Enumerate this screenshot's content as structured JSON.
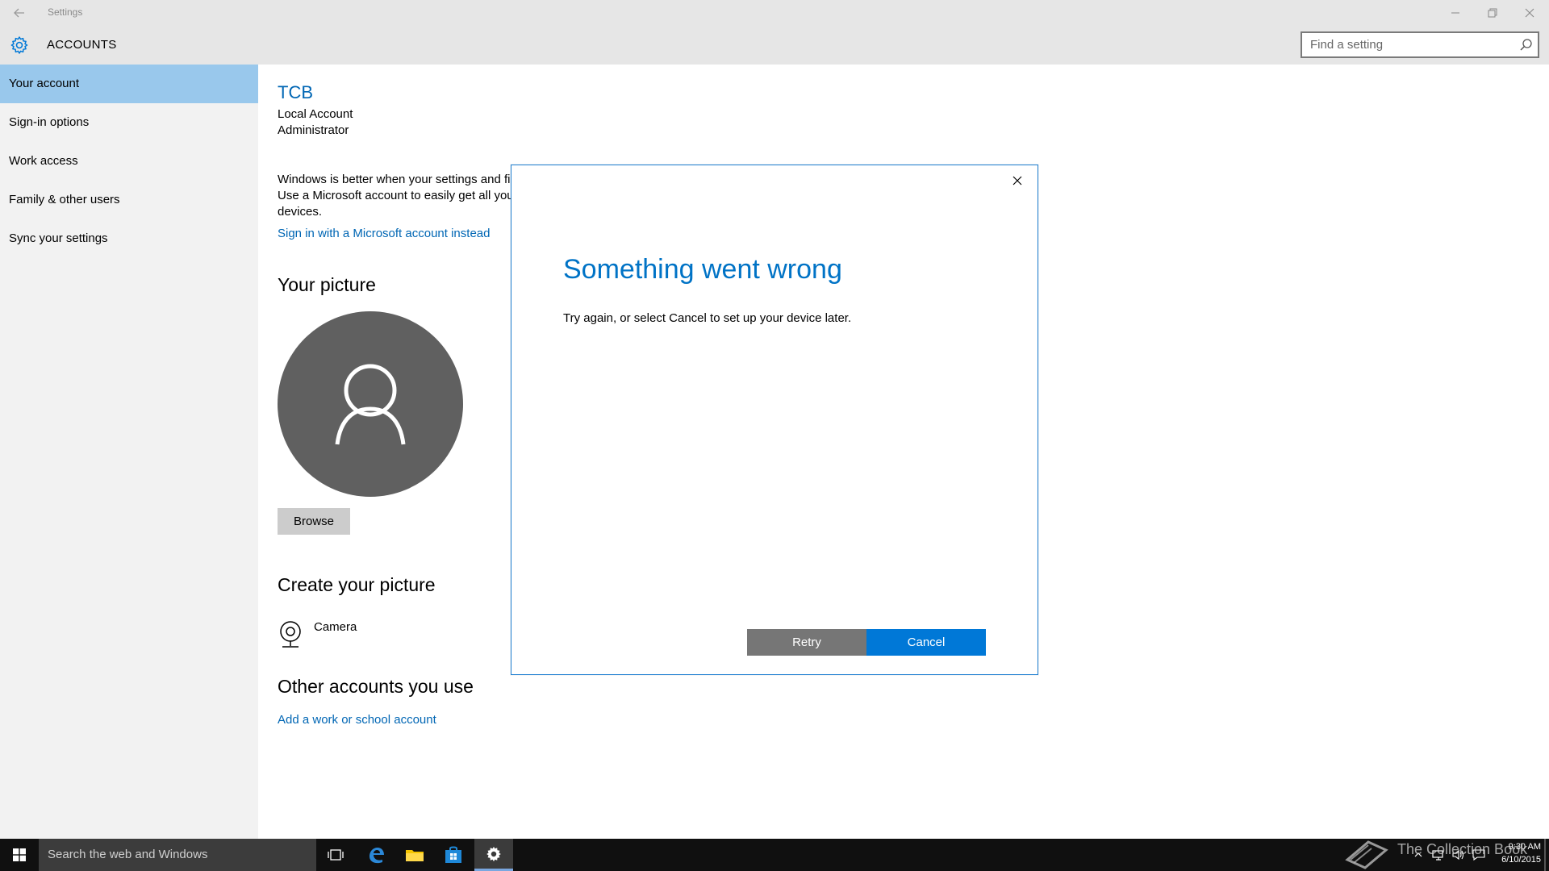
{
  "window": {
    "app_title": "Settings"
  },
  "header": {
    "section_title": "ACCOUNTS",
    "search_placeholder": "Find a setting"
  },
  "sidebar": {
    "items": [
      {
        "label": "Your account",
        "active": true
      },
      {
        "label": "Sign-in options",
        "active": false
      },
      {
        "label": "Work access",
        "active": false
      },
      {
        "label": "Family & other users",
        "active": false
      },
      {
        "label": "Sync your settings",
        "active": false
      }
    ]
  },
  "main": {
    "user_name": "TCB",
    "account_type": "Local Account",
    "role": "Administrator",
    "info_lines": [
      "Windows is better when your settings and fi",
      "Use a Microsoft account to easily get all you",
      "devices."
    ],
    "signin_link": "Sign in with a Microsoft account instead",
    "picture_heading": "Your picture",
    "browse_label": "Browse",
    "create_heading": "Create your picture",
    "camera_label": "Camera",
    "other_heading": "Other accounts you use",
    "add_account_link": "Add a work or school account"
  },
  "dialog": {
    "title": "Something went wrong",
    "message": "Try again, or select Cancel to set up your device later.",
    "retry_label": "Retry",
    "cancel_label": "Cancel"
  },
  "taskbar": {
    "search_text": "Search the web and Windows",
    "watermark_text": "The Collection Book",
    "time": "9:30 AM",
    "date": "6/10/2015"
  },
  "colors": {
    "accent": "#0078d7",
    "link": "#0066b4",
    "active_nav": "#99c8ec",
    "retry_button": "#767676"
  }
}
